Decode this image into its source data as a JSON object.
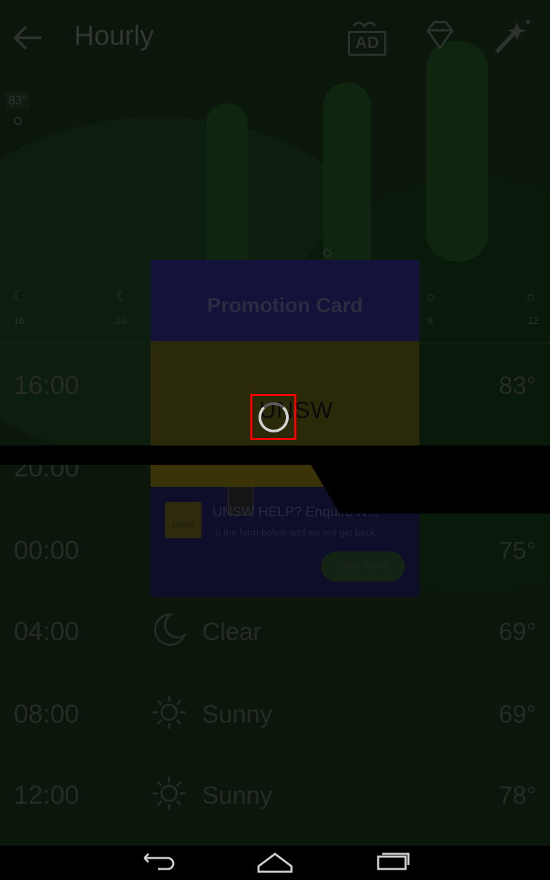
{
  "header": {
    "title": "Hourly",
    "ad_label": "AD"
  },
  "strip": {
    "current_temp": "83°",
    "times": [
      "16",
      "20",
      "",
      "",
      "",
      "8",
      "12"
    ]
  },
  "rows": [
    {
      "time": "16:00",
      "condition": "",
      "temp": "83°"
    },
    {
      "time": "20:00",
      "condition": "",
      "temp": ""
    },
    {
      "time": "00:00",
      "condition": "",
      "temp": "75°"
    },
    {
      "time": "04:00",
      "condition": "Clear",
      "temp": "69°"
    },
    {
      "time": "08:00",
      "condition": "Sunny",
      "temp": "69°"
    },
    {
      "time": "12:00",
      "condition": "Sunny",
      "temp": "78°"
    }
  ],
  "promo": {
    "title": "Promotion Card",
    "banner_word": "UNSW",
    "logo_text": "UNSW",
    "headline": "UNSW HELP? Enquire N...",
    "subtext": "it the form below and we will get back",
    "button": "View More"
  },
  "colors": {
    "highlight": "#ff0000",
    "overlay": "#000000"
  }
}
